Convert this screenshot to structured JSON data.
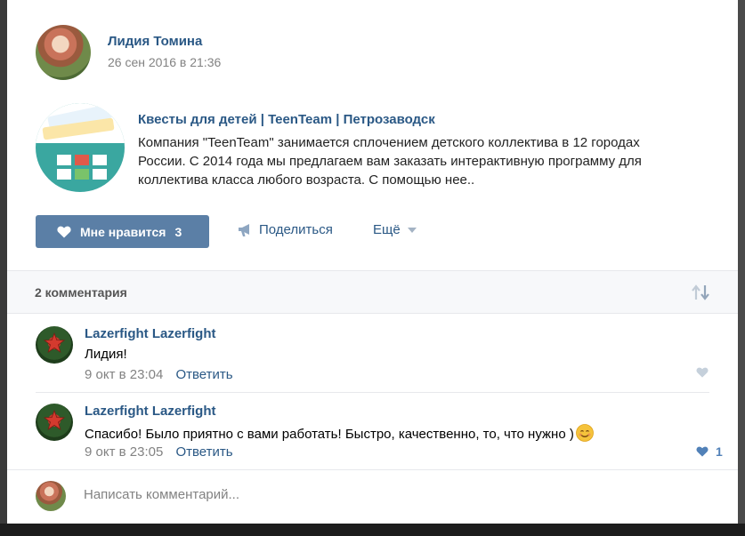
{
  "post": {
    "author": "Лидия Томина",
    "date": "26 сен 2016 в 21:36"
  },
  "snippet": {
    "title": "Квесты для детей | TeenTeam | Петрозаводск",
    "description": "Компания \"TeenTeam\" занимается сплочением детского коллектива в 12 городах России. С 2014 года мы предлагаем вам заказать интерактивную программу для коллектива класса любого возраста. С помощью нее.."
  },
  "actions": {
    "like_label": "Мне нравится",
    "like_count": "3",
    "share_label": "Поделиться",
    "more_label": "Ещё"
  },
  "comments_header": {
    "count_label": "2 комментария"
  },
  "comments": [
    {
      "author": "Lazerfight Lazerfight",
      "text": "Лидия!",
      "date": "9 окт в 23:04",
      "reply_label": "Ответить",
      "likes": ""
    },
    {
      "author": "Lazerfight Lazerfight",
      "text": "Спасибо! Было приятно с вами работать! Быстро, качественно, то, что нужно )",
      "date": "9 окт в 23:05",
      "reply_label": "Ответить",
      "likes": "1"
    }
  ],
  "reply": {
    "placeholder": "Написать комментарий..."
  },
  "colors": {
    "link": "#2a5885",
    "like_button_bg": "#5b7fa6",
    "liked_heart": "#5181b8",
    "unliked_heart": "#c5d0db",
    "muted_text": "#828282"
  }
}
